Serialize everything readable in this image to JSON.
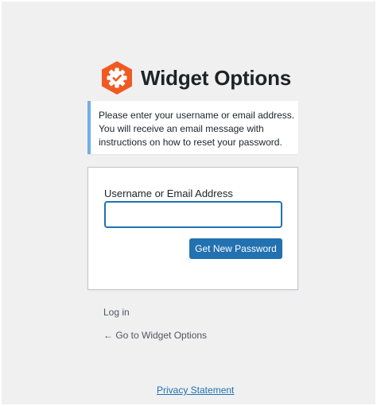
{
  "logo": {
    "text": "Widget Options",
    "icon": "hexagon-gear-check-icon",
    "icon_color": "#f05a22"
  },
  "message": {
    "lines": [
      "Please enter your username or email address.",
      "You will receive an email message with",
      "instructions on how to reset your password."
    ],
    "accent_color": "#72aee6"
  },
  "form": {
    "label": "Username or Email Address",
    "input_value": "",
    "submit_label": "Get New Password"
  },
  "nav": {
    "login_label": "Log in",
    "back_label": "← Go to Widget Options"
  },
  "footer": {
    "privacy_label": "Privacy Statement"
  },
  "colors": {
    "primary": "#2271b1",
    "background": "#f0f0f1",
    "text": "#1d2327"
  }
}
